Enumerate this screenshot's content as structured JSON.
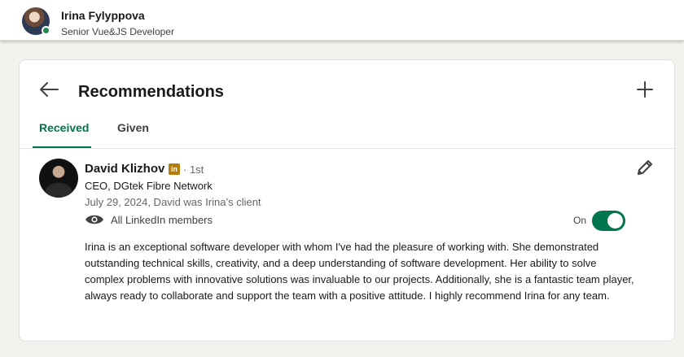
{
  "header": {
    "name": "Irina Fylyppova",
    "headline": "Senior Vue&JS Developer",
    "online_status_color": "#1e8a4c"
  },
  "card": {
    "title": "Recommendations",
    "back_icon": "arrow-left-icon",
    "add_icon": "plus-icon"
  },
  "tabs": [
    {
      "label": "Received",
      "active": true
    },
    {
      "label": "Given",
      "active": false
    }
  ],
  "recommendation": {
    "name": "David Klizhov",
    "badge_icon": "linkedin-icon",
    "badge_text": "in",
    "degree": "· 1st",
    "title": "CEO, DGtek Fibre Network",
    "meta": "July 29, 2024, David was Irina’s client",
    "visibility_icon": "eye-icon",
    "visibility": "All LinkedIn members",
    "toggle_label": "On",
    "toggle_on": true,
    "edit_icon": "pencil-icon",
    "text": "Irina is an exceptional software developer with whom I've had the pleasure of working with. She demonstrated outstanding technical skills, creativity, and a deep understanding of software development. Her ability to solve complex problems with innovative solutions was invaluable to our projects. Additionally, she is a fantastic team player, always ready to collaborate and support the team with a positive attitude. I highly recommend Irina for any team."
  },
  "colors": {
    "accent": "#01754f",
    "background": "#f4f2ee",
    "linkedin_badge": "#b57c0e"
  }
}
